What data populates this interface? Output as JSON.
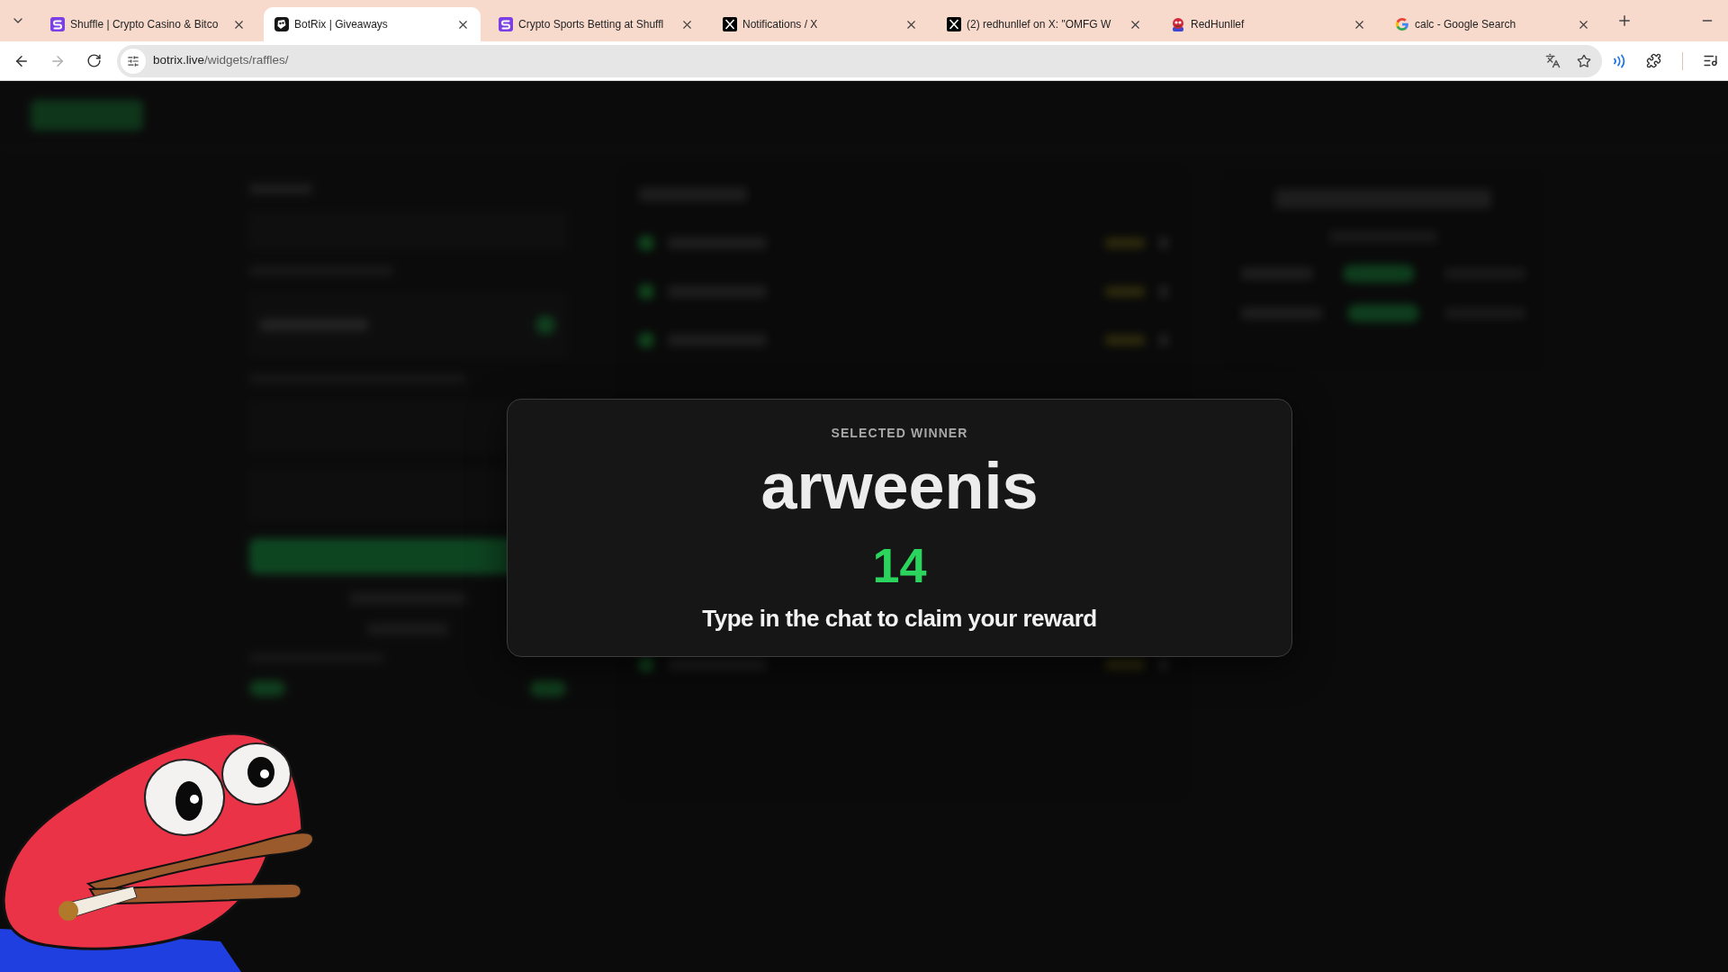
{
  "browser": {
    "tabs": [
      {
        "title": "Shuffle | Crypto Casino & Bitco",
        "kind": "shuffle",
        "selected": false
      },
      {
        "title": "BotRix | Giveaways",
        "kind": "botrix",
        "selected": true
      },
      {
        "title": "Crypto Sports Betting at Shuffl",
        "kind": "shuffle",
        "selected": false
      },
      {
        "title": "Notifications / X",
        "kind": "x",
        "selected": false
      },
      {
        "title": "(2) redhunllef on X: \"OMFG W",
        "kind": "x",
        "selected": false
      },
      {
        "title": "RedHunllef",
        "kind": "avatar",
        "selected": false
      },
      {
        "title": "calc - Google Search",
        "kind": "google",
        "selected": false
      }
    ],
    "navigation": {
      "back_disabled": false,
      "forward_disabled": true
    },
    "address_bar": {
      "host": "botrix.live",
      "path": "/widgets/raffles/"
    }
  },
  "winner_modal": {
    "heading": "SELECTED WINNER",
    "winner": "arweenis",
    "countdown": "14",
    "message": "Type in the chat to claim your reward"
  }
}
